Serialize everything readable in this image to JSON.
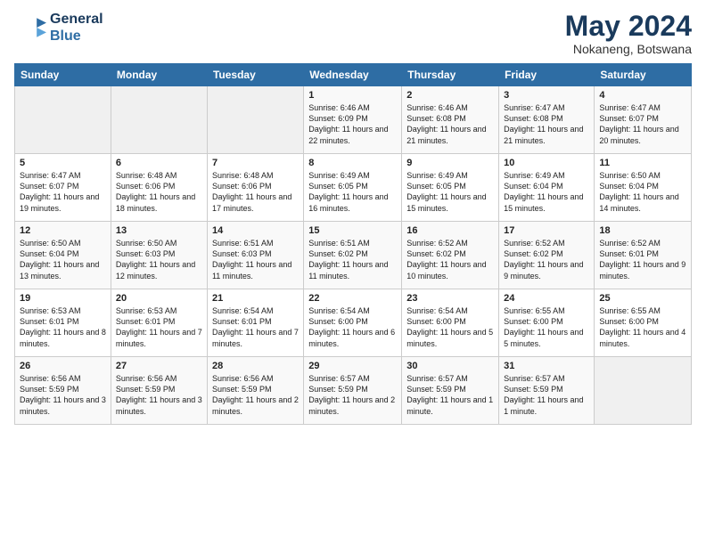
{
  "header": {
    "logo_line1": "General",
    "logo_line2": "Blue",
    "month_title": "May 2024",
    "location": "Nokaneng, Botswana"
  },
  "weekdays": [
    "Sunday",
    "Monday",
    "Tuesday",
    "Wednesday",
    "Thursday",
    "Friday",
    "Saturday"
  ],
  "weeks": [
    [
      {
        "day": "",
        "sunrise": "",
        "sunset": "",
        "daylight": ""
      },
      {
        "day": "",
        "sunrise": "",
        "sunset": "",
        "daylight": ""
      },
      {
        "day": "",
        "sunrise": "",
        "sunset": "",
        "daylight": ""
      },
      {
        "day": "1",
        "sunrise": "Sunrise: 6:46 AM",
        "sunset": "Sunset: 6:09 PM",
        "daylight": "Daylight: 11 hours and 22 minutes."
      },
      {
        "day": "2",
        "sunrise": "Sunrise: 6:46 AM",
        "sunset": "Sunset: 6:08 PM",
        "daylight": "Daylight: 11 hours and 21 minutes."
      },
      {
        "day": "3",
        "sunrise": "Sunrise: 6:47 AM",
        "sunset": "Sunset: 6:08 PM",
        "daylight": "Daylight: 11 hours and 21 minutes."
      },
      {
        "day": "4",
        "sunrise": "Sunrise: 6:47 AM",
        "sunset": "Sunset: 6:07 PM",
        "daylight": "Daylight: 11 hours and 20 minutes."
      }
    ],
    [
      {
        "day": "5",
        "sunrise": "Sunrise: 6:47 AM",
        "sunset": "Sunset: 6:07 PM",
        "daylight": "Daylight: 11 hours and 19 minutes."
      },
      {
        "day": "6",
        "sunrise": "Sunrise: 6:48 AM",
        "sunset": "Sunset: 6:06 PM",
        "daylight": "Daylight: 11 hours and 18 minutes."
      },
      {
        "day": "7",
        "sunrise": "Sunrise: 6:48 AM",
        "sunset": "Sunset: 6:06 PM",
        "daylight": "Daylight: 11 hours and 17 minutes."
      },
      {
        "day": "8",
        "sunrise": "Sunrise: 6:49 AM",
        "sunset": "Sunset: 6:05 PM",
        "daylight": "Daylight: 11 hours and 16 minutes."
      },
      {
        "day": "9",
        "sunrise": "Sunrise: 6:49 AM",
        "sunset": "Sunset: 6:05 PM",
        "daylight": "Daylight: 11 hours and 15 minutes."
      },
      {
        "day": "10",
        "sunrise": "Sunrise: 6:49 AM",
        "sunset": "Sunset: 6:04 PM",
        "daylight": "Daylight: 11 hours and 15 minutes."
      },
      {
        "day": "11",
        "sunrise": "Sunrise: 6:50 AM",
        "sunset": "Sunset: 6:04 PM",
        "daylight": "Daylight: 11 hours and 14 minutes."
      }
    ],
    [
      {
        "day": "12",
        "sunrise": "Sunrise: 6:50 AM",
        "sunset": "Sunset: 6:04 PM",
        "daylight": "Daylight: 11 hours and 13 minutes."
      },
      {
        "day": "13",
        "sunrise": "Sunrise: 6:50 AM",
        "sunset": "Sunset: 6:03 PM",
        "daylight": "Daylight: 11 hours and 12 minutes."
      },
      {
        "day": "14",
        "sunrise": "Sunrise: 6:51 AM",
        "sunset": "Sunset: 6:03 PM",
        "daylight": "Daylight: 11 hours and 11 minutes."
      },
      {
        "day": "15",
        "sunrise": "Sunrise: 6:51 AM",
        "sunset": "Sunset: 6:02 PM",
        "daylight": "Daylight: 11 hours and 11 minutes."
      },
      {
        "day": "16",
        "sunrise": "Sunrise: 6:52 AM",
        "sunset": "Sunset: 6:02 PM",
        "daylight": "Daylight: 11 hours and 10 minutes."
      },
      {
        "day": "17",
        "sunrise": "Sunrise: 6:52 AM",
        "sunset": "Sunset: 6:02 PM",
        "daylight": "Daylight: 11 hours and 9 minutes."
      },
      {
        "day": "18",
        "sunrise": "Sunrise: 6:52 AM",
        "sunset": "Sunset: 6:01 PM",
        "daylight": "Daylight: 11 hours and 9 minutes."
      }
    ],
    [
      {
        "day": "19",
        "sunrise": "Sunrise: 6:53 AM",
        "sunset": "Sunset: 6:01 PM",
        "daylight": "Daylight: 11 hours and 8 minutes."
      },
      {
        "day": "20",
        "sunrise": "Sunrise: 6:53 AM",
        "sunset": "Sunset: 6:01 PM",
        "daylight": "Daylight: 11 hours and 7 minutes."
      },
      {
        "day": "21",
        "sunrise": "Sunrise: 6:54 AM",
        "sunset": "Sunset: 6:01 PM",
        "daylight": "Daylight: 11 hours and 7 minutes."
      },
      {
        "day": "22",
        "sunrise": "Sunrise: 6:54 AM",
        "sunset": "Sunset: 6:00 PM",
        "daylight": "Daylight: 11 hours and 6 minutes."
      },
      {
        "day": "23",
        "sunrise": "Sunrise: 6:54 AM",
        "sunset": "Sunset: 6:00 PM",
        "daylight": "Daylight: 11 hours and 5 minutes."
      },
      {
        "day": "24",
        "sunrise": "Sunrise: 6:55 AM",
        "sunset": "Sunset: 6:00 PM",
        "daylight": "Daylight: 11 hours and 5 minutes."
      },
      {
        "day": "25",
        "sunrise": "Sunrise: 6:55 AM",
        "sunset": "Sunset: 6:00 PM",
        "daylight": "Daylight: 11 hours and 4 minutes."
      }
    ],
    [
      {
        "day": "26",
        "sunrise": "Sunrise: 6:56 AM",
        "sunset": "Sunset: 5:59 PM",
        "daylight": "Daylight: 11 hours and 3 minutes."
      },
      {
        "day": "27",
        "sunrise": "Sunrise: 6:56 AM",
        "sunset": "Sunset: 5:59 PM",
        "daylight": "Daylight: 11 hours and 3 minutes."
      },
      {
        "day": "28",
        "sunrise": "Sunrise: 6:56 AM",
        "sunset": "Sunset: 5:59 PM",
        "daylight": "Daylight: 11 hours and 2 minutes."
      },
      {
        "day": "29",
        "sunrise": "Sunrise: 6:57 AM",
        "sunset": "Sunset: 5:59 PM",
        "daylight": "Daylight: 11 hours and 2 minutes."
      },
      {
        "day": "30",
        "sunrise": "Sunrise: 6:57 AM",
        "sunset": "Sunset: 5:59 PM",
        "daylight": "Daylight: 11 hours and 1 minute."
      },
      {
        "day": "31",
        "sunrise": "Sunrise: 6:57 AM",
        "sunset": "Sunset: 5:59 PM",
        "daylight": "Daylight: 11 hours and 1 minute."
      },
      {
        "day": "",
        "sunrise": "",
        "sunset": "",
        "daylight": ""
      }
    ]
  ]
}
